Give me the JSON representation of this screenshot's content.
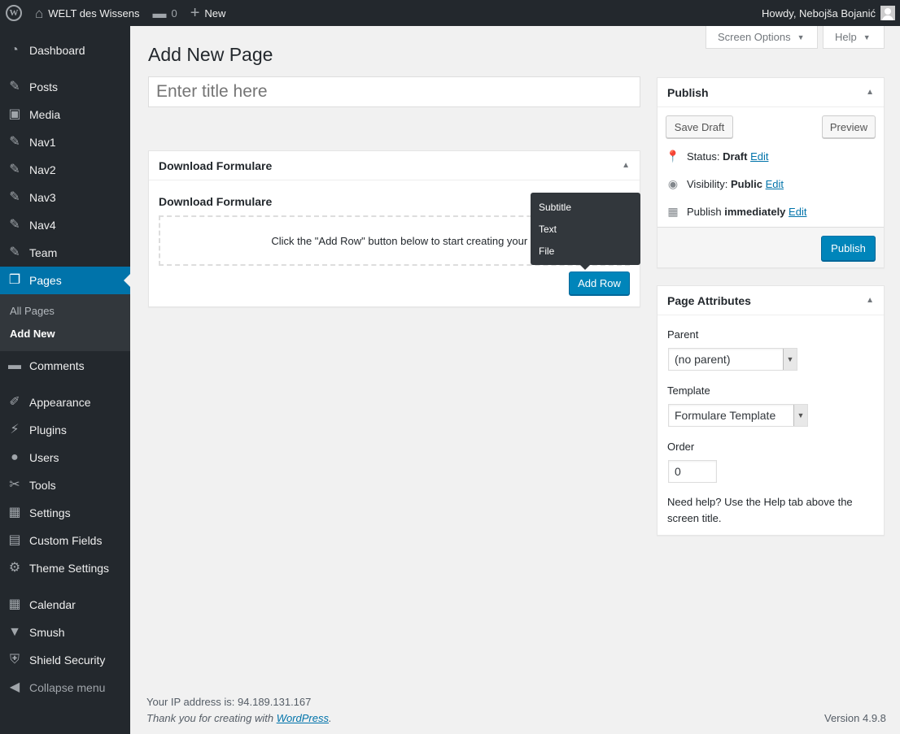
{
  "adminbar": {
    "logo_glyph": "W",
    "site_name": "WELT des Wissens",
    "comments_count": "0",
    "new_label": "New",
    "howdy": "Howdy, Nebojša Bojanić"
  },
  "sidebar": {
    "items": [
      {
        "label": "Dashboard",
        "icon": "dashboard-icon",
        "glyph": "◔"
      },
      {
        "label": "Posts",
        "icon": "pin-icon",
        "glyph": "✎"
      },
      {
        "label": "Media",
        "icon": "media-icon",
        "glyph": "▣"
      },
      {
        "label": "Nav1",
        "icon": "pin-icon",
        "glyph": "✎"
      },
      {
        "label": "Nav2",
        "icon": "pin-icon",
        "glyph": "✎"
      },
      {
        "label": "Nav3",
        "icon": "pin-icon",
        "glyph": "✎"
      },
      {
        "label": "Nav4",
        "icon": "pin-icon",
        "glyph": "✎"
      },
      {
        "label": "Team",
        "icon": "pin-icon",
        "glyph": "✎"
      },
      {
        "label": "Pages",
        "icon": "pages-icon",
        "glyph": "❐"
      },
      {
        "label": "Comments",
        "icon": "comments-icon",
        "glyph": "▬"
      },
      {
        "label": "Appearance",
        "icon": "appearance-icon",
        "glyph": "✐"
      },
      {
        "label": "Plugins",
        "icon": "plugins-icon",
        "glyph": "⚡"
      },
      {
        "label": "Users",
        "icon": "users-icon",
        "glyph": "●"
      },
      {
        "label": "Tools",
        "icon": "tools-icon",
        "glyph": "✂"
      },
      {
        "label": "Settings",
        "icon": "settings-icon",
        "glyph": "▦"
      },
      {
        "label": "Custom Fields",
        "icon": "custom-fields-icon",
        "glyph": "▤"
      },
      {
        "label": "Theme Settings",
        "icon": "gear-icon",
        "glyph": "⚙"
      },
      {
        "label": "Calendar",
        "icon": "calendar-icon",
        "glyph": "▦"
      },
      {
        "label": "Smush",
        "icon": "smush-icon",
        "glyph": "▼"
      },
      {
        "label": "Shield Security",
        "icon": "shield-icon",
        "glyph": "⛨"
      },
      {
        "label": "Collapse menu",
        "icon": "collapse-icon",
        "glyph": "◀"
      }
    ],
    "submenu": [
      "All Pages",
      "Add New"
    ]
  },
  "screen_options_label": "Screen Options",
  "help_label": "Help",
  "page_title": "Add New Page",
  "title_placeholder": "Enter title here",
  "download_box": {
    "heading": "Download Formulare",
    "field_label": "Download Formulare",
    "empty_text": "Click the \"Add Row\" button below to start creating your layo",
    "add_row_label": "Add Row"
  },
  "popup_items": [
    "Subtitle",
    "Text",
    "File"
  ],
  "publish": {
    "heading": "Publish",
    "save_draft": "Save Draft",
    "preview": "Preview",
    "status_label": "Status:",
    "status_value": "Draft",
    "visibility_label": "Visibility:",
    "visibility_value": "Public",
    "publish_label": "Publish",
    "publish_value": "immediately",
    "edit": "Edit",
    "publish_button": "Publish"
  },
  "attributes": {
    "heading": "Page Attributes",
    "parent_label": "Parent",
    "parent_value": "(no parent)",
    "template_label": "Template",
    "template_value": "Formulare Template",
    "order_label": "Order",
    "order_value": "0",
    "help_line1": "Need help? Use the Help tab above the",
    "help_line2": "screen title."
  },
  "footer": {
    "ip_text": "Your IP address is: 94.189.131.167",
    "thanks": "Thank you for creating with",
    "wp_link": "WordPress",
    "version": "Version 4.9.8"
  }
}
